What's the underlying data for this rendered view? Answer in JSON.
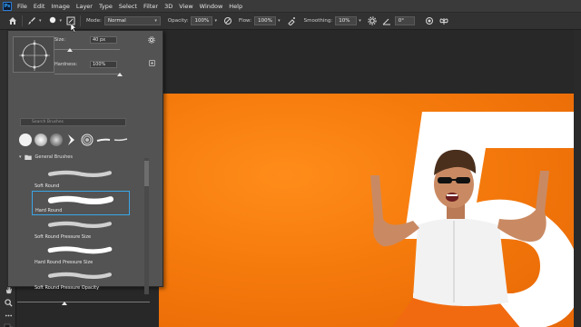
{
  "menu": {
    "app_logo": "Ps",
    "items": [
      "File",
      "Edit",
      "Image",
      "Layer",
      "Type",
      "Select",
      "Filter",
      "3D",
      "View",
      "Window",
      "Help"
    ]
  },
  "options": {
    "mode_label": "Mode:",
    "mode_value": "Normal",
    "opacity_label": "Opacity:",
    "opacity_value": "100%",
    "flow_label": "Flow:",
    "flow_value": "100%",
    "smoothing_label": "Smoothing:",
    "smoothing_value": "10%",
    "angle_value": "0°"
  },
  "brush_panel": {
    "size_label": "Size:",
    "size_value": "40 px",
    "hardness_label": "Hardness:",
    "hardness_value": "100%",
    "size_level": 0.24,
    "hardness_level": 1.0,
    "search_placeholder": "Search Brushes",
    "group_name": "General Brushes",
    "brushes": [
      {
        "name": "Soft Round",
        "selected": false
      },
      {
        "name": "Hard Round",
        "selected": true
      },
      {
        "name": "Soft Round Pressure Size",
        "selected": false
      },
      {
        "name": "Hard Round Pressure Size",
        "selected": false
      },
      {
        "name": "Soft Round Pressure Opacity",
        "selected": false
      }
    ]
  },
  "colors": {
    "accent": "#31a8ff",
    "selection": "#3aa6e6",
    "canvas_orange": "#f57a0c"
  }
}
